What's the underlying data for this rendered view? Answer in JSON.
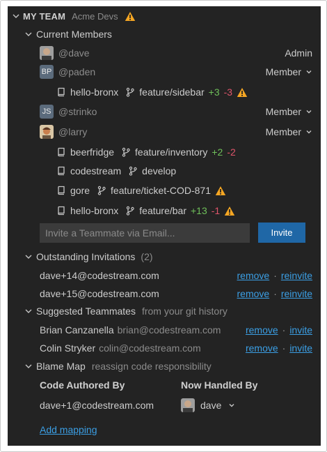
{
  "header": {
    "title": "MY TEAM",
    "team": "Acme Devs"
  },
  "current_members": {
    "title": "Current Members",
    "members": [
      {
        "username": "@dave",
        "role": "Admin",
        "avatar": "photo-dave"
      },
      {
        "username": "@paden",
        "role": "Member",
        "avatar_initials": "BP",
        "repos": [
          {
            "repo": "hello-bronx",
            "branch": "feature/sidebar",
            "added": "+3",
            "removed": "-3",
            "warning": true
          }
        ]
      },
      {
        "username": "@strinko",
        "role": "Member",
        "avatar_initials": "JS"
      },
      {
        "username": "@larry",
        "role": "Member",
        "avatar": "photo-larry",
        "repos": [
          {
            "repo": "beerfridge",
            "branch": "feature/inventory",
            "added": "+2",
            "removed": "-2",
            "warning": false
          },
          {
            "repo": "codestream",
            "branch": "develop",
            "added": "",
            "removed": "",
            "warning": false
          },
          {
            "repo": "gore",
            "branch": "feature/ticket-COD-871",
            "added": "",
            "removed": "",
            "warning": true
          },
          {
            "repo": "hello-bronx",
            "branch": "feature/bar",
            "added": "+13",
            "removed": "-1",
            "warning": true
          }
        ]
      }
    ],
    "invite_placeholder": "Invite a Teammate via Email...",
    "invite_button": "Invite"
  },
  "outstanding": {
    "title": "Outstanding Invitations",
    "count": "(2)",
    "items": [
      {
        "email": "dave+14@codestream.com",
        "remove": "remove",
        "reinvite": "reinvite"
      },
      {
        "email": "dave+15@codestream.com",
        "remove": "remove",
        "reinvite": "reinvite"
      }
    ]
  },
  "suggested": {
    "title": "Suggested Teammates",
    "subtitle": "from your git history",
    "items": [
      {
        "name": "Brian Canzanella",
        "email": "brian@codestream.com",
        "remove": "remove",
        "invite": "invite"
      },
      {
        "name": "Colin Stryker",
        "email": "colin@codestream.com",
        "remove": "remove",
        "invite": "invite"
      }
    ]
  },
  "blame_map": {
    "title": "Blame Map",
    "subtitle": "reassign code responsibility",
    "col_authored": "Code Authored By",
    "col_handled": "Now Handled By",
    "rows": [
      {
        "author": "dave+1@codestream.com",
        "handler": "dave"
      }
    ],
    "add_mapping": "Add mapping"
  },
  "colors": {
    "background": "#232323",
    "link": "#3b9fe5",
    "button": "#1f67a6",
    "added": "#6fbf5a",
    "removed": "#e0556b",
    "warning": "#f5a623"
  }
}
